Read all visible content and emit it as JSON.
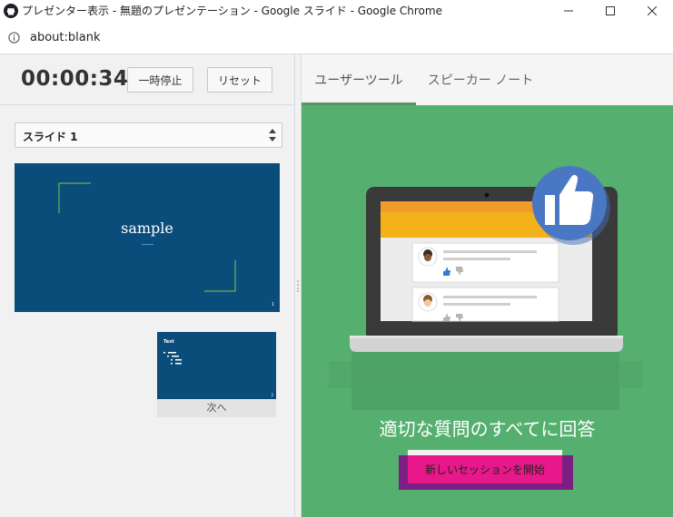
{
  "window": {
    "title": "プレゼンター表示 - 無題のプレゼンテーション - Google スライド - Google Chrome"
  },
  "address": {
    "url": "about:blank"
  },
  "timer": {
    "time": "00:00:34",
    "pause_label": "一時停止",
    "reset_label": "リセット"
  },
  "slide_select": {
    "value": "スライド 1"
  },
  "current_slide": {
    "title": "sample",
    "number": "1"
  },
  "next_slide": {
    "title": "Text",
    "number": "2",
    "label": "次へ"
  },
  "tabs": [
    {
      "label": "ユーザーツール",
      "active": true
    },
    {
      "label": "スピーカー ノート",
      "active": false
    }
  ],
  "promo": {
    "heading": "適切な質問のすべてに回答",
    "button_label": "新しいセッションを開始"
  },
  "colors": {
    "green_panel": "#55b070",
    "slide_bg": "#0a4d7b",
    "cta": "#e8178a",
    "cta_shadow": "#7b1f85",
    "thumbs_badge": "#4a77c4"
  }
}
